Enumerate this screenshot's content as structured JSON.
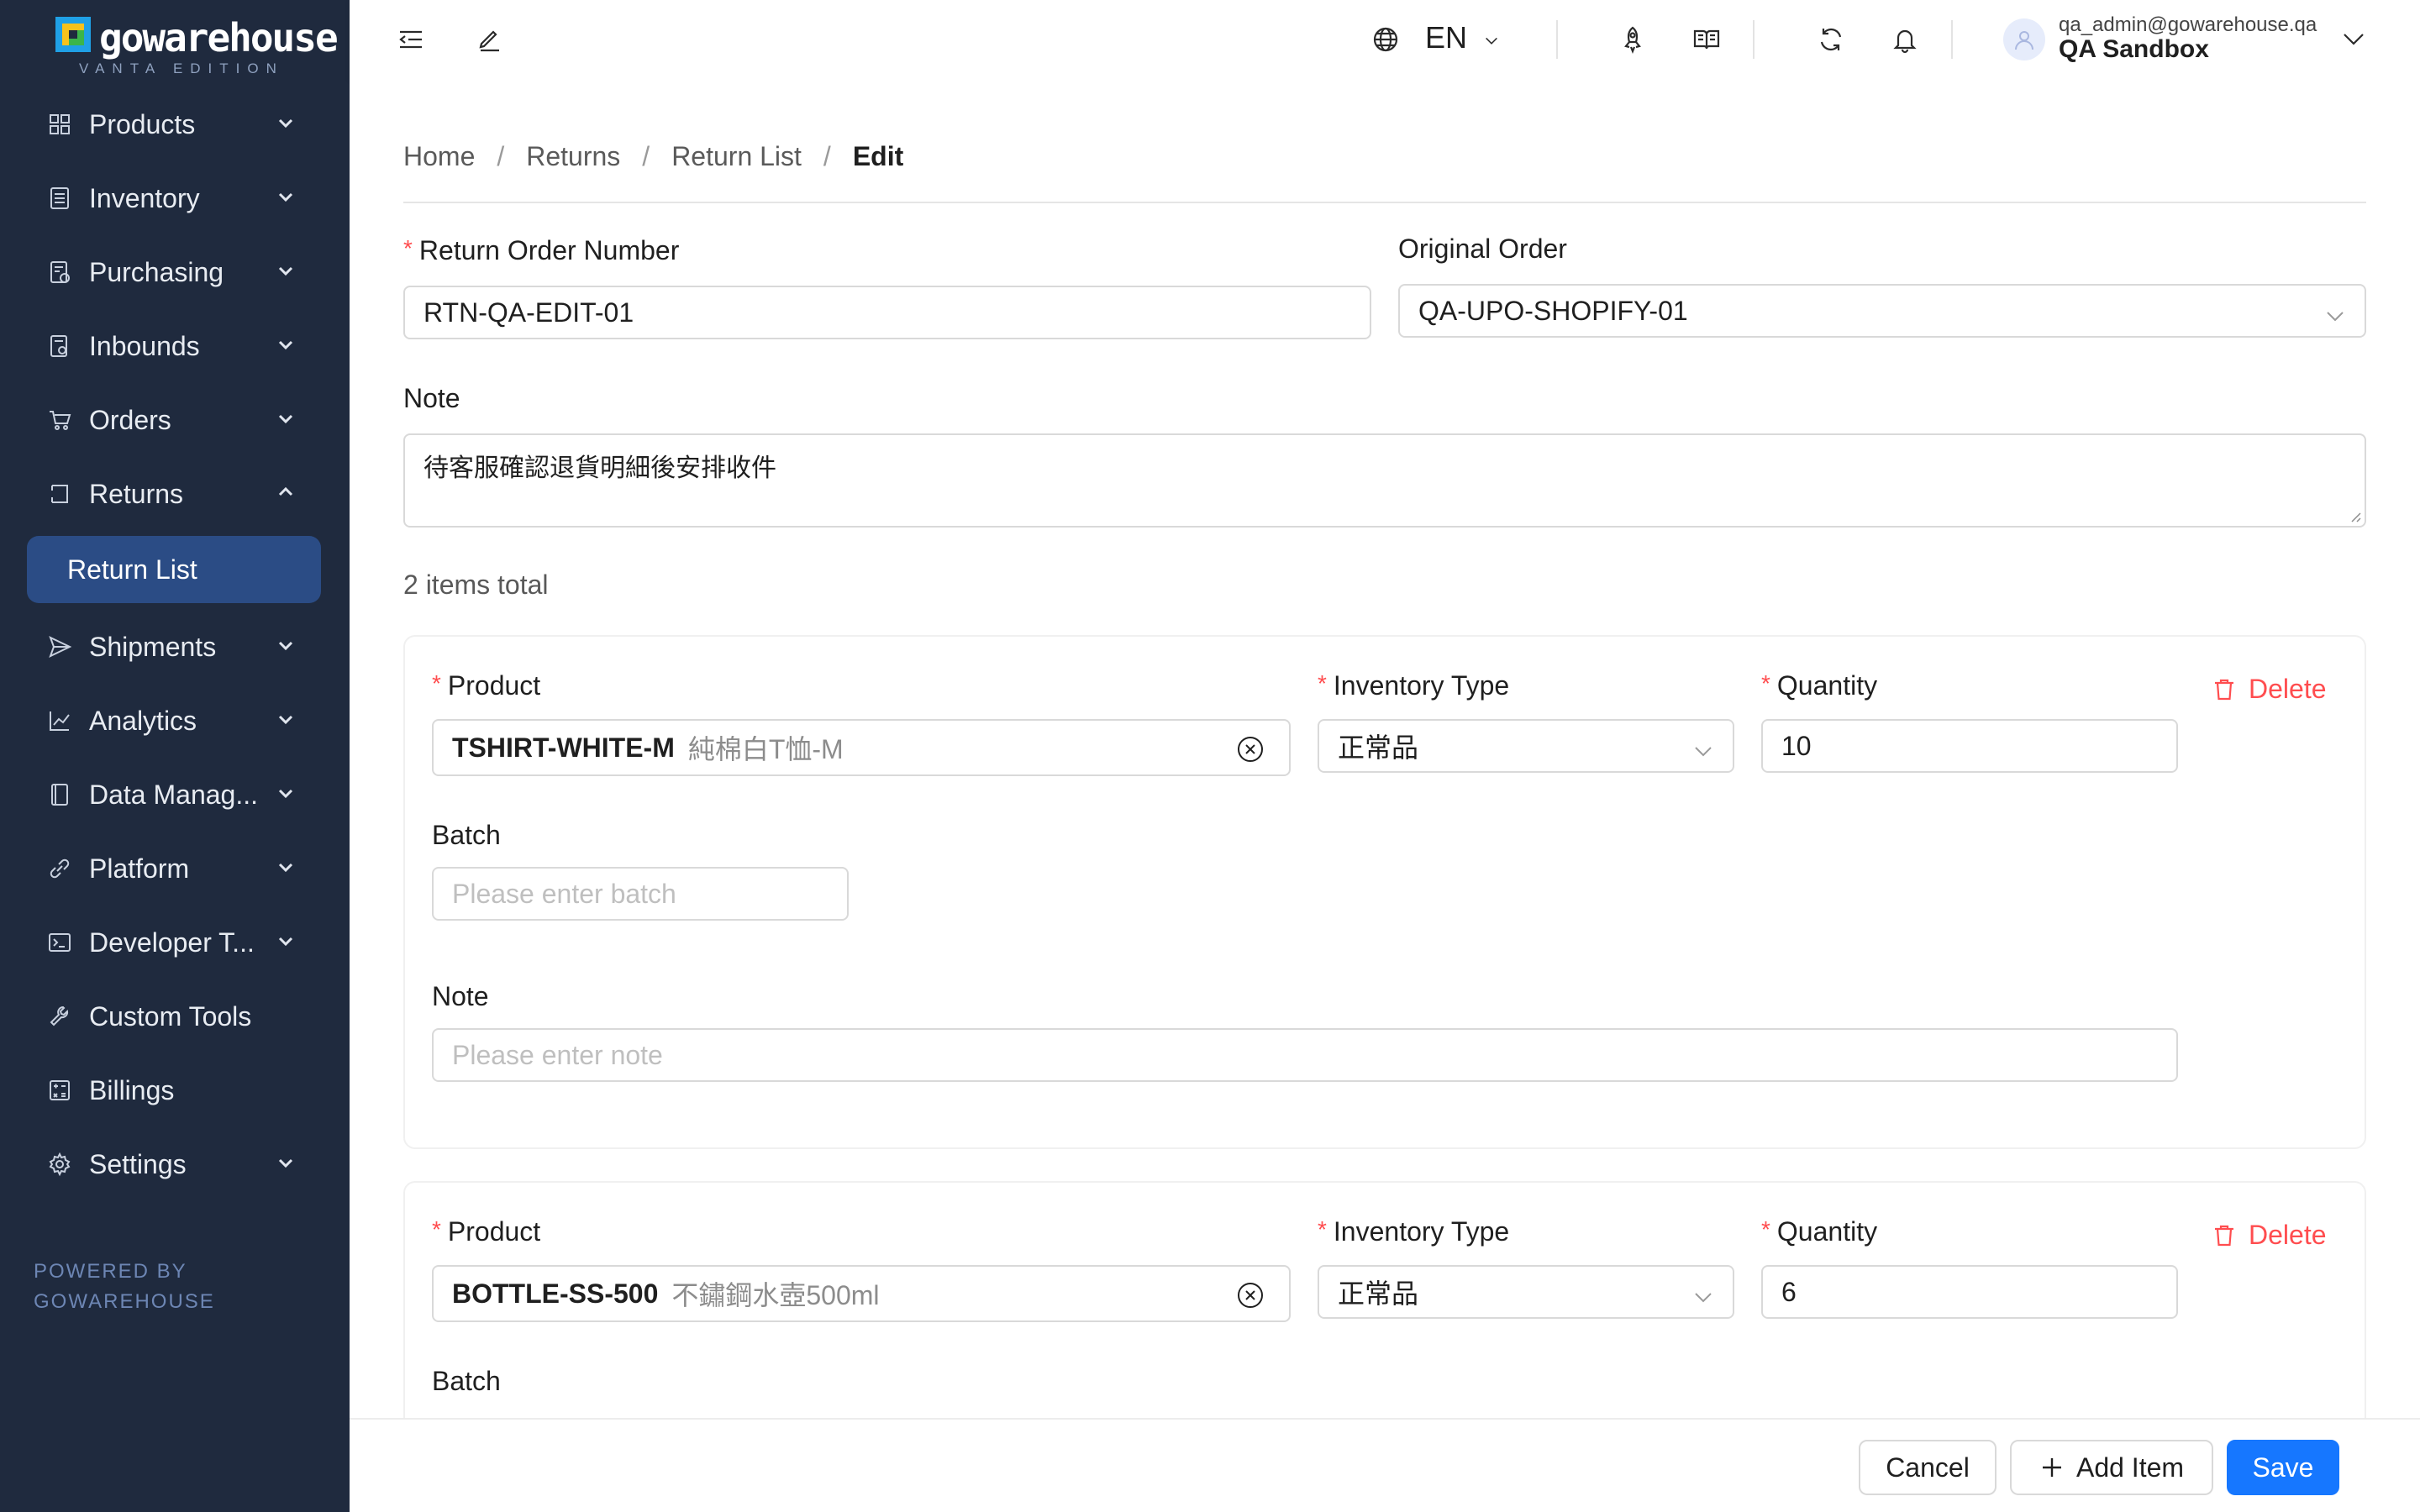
{
  "brand": {
    "name": "gowarehouse",
    "edition": "VANTA EDITION",
    "powered_line1": "POWERED BY",
    "powered_line2": "GOWAREHOUSE"
  },
  "sidebar": {
    "items": [
      {
        "label": "Products",
        "icon": "grid-icon",
        "expandable": true
      },
      {
        "label": "Inventory",
        "icon": "list-icon",
        "expandable": true
      },
      {
        "label": "Purchasing",
        "icon": "purchase-icon",
        "expandable": true
      },
      {
        "label": "Inbounds",
        "icon": "inbound-icon",
        "expandable": true
      },
      {
        "label": "Orders",
        "icon": "cart-icon",
        "expandable": true
      },
      {
        "label": "Returns",
        "icon": "return-icon",
        "expandable": true,
        "expanded": true
      },
      {
        "label": "Shipments",
        "icon": "send-icon",
        "expandable": true
      },
      {
        "label": "Analytics",
        "icon": "chart-icon",
        "expandable": true
      },
      {
        "label": "Data Manag...",
        "icon": "book-icon",
        "expandable": true
      },
      {
        "label": "Platform",
        "icon": "link-icon",
        "expandable": true
      },
      {
        "label": "Developer T...",
        "icon": "terminal-icon",
        "expandable": true
      },
      {
        "label": "Custom Tools",
        "icon": "wrench-icon",
        "expandable": false
      },
      {
        "label": "Billings",
        "icon": "calculator-icon",
        "expandable": false
      },
      {
        "label": "Settings",
        "icon": "gear-icon",
        "expandable": true
      }
    ],
    "active_sub": "Return List"
  },
  "header": {
    "language": "EN",
    "user_email": "qa_admin@gowarehouse.qa",
    "user_org": "QA Sandbox"
  },
  "breadcrumb": [
    "Home",
    "Returns",
    "Return List",
    "Edit"
  ],
  "form": {
    "return_order_label": "Return Order Number",
    "return_order_value": "RTN-QA-EDIT-01",
    "original_order_label": "Original Order",
    "original_order_value": "QA-UPO-SHOPIFY-01",
    "note_label": "Note",
    "note_value": "待客服確認退貨明細後安排收件",
    "items_total": "2 items total"
  },
  "items": [
    {
      "product_label": "Product",
      "product_code": "TSHIRT-WHITE-M",
      "product_name": "純棉白T恤-M",
      "inventory_type_label": "Inventory Type",
      "inventory_type": "正常品",
      "quantity_label": "Quantity",
      "quantity": "10",
      "batch_label": "Batch",
      "batch_placeholder": "Please enter batch",
      "note_label": "Note",
      "note_placeholder": "Please enter note",
      "delete_label": "Delete"
    },
    {
      "product_label": "Product",
      "product_code": "BOTTLE-SS-500",
      "product_name": "不鏽鋼水壺500ml",
      "inventory_type_label": "Inventory Type",
      "inventory_type": "正常品",
      "quantity_label": "Quantity",
      "quantity": "6",
      "batch_label": "Batch",
      "delete_label": "Delete"
    }
  ],
  "footer": {
    "cancel": "Cancel",
    "add_item": "Add Item",
    "save": "Save"
  },
  "colors": {
    "sidebar_bg": "#1f2a3e",
    "active_sub_bg": "#2b4c85",
    "primary": "#1677ff",
    "danger": "#ff4d4f"
  }
}
